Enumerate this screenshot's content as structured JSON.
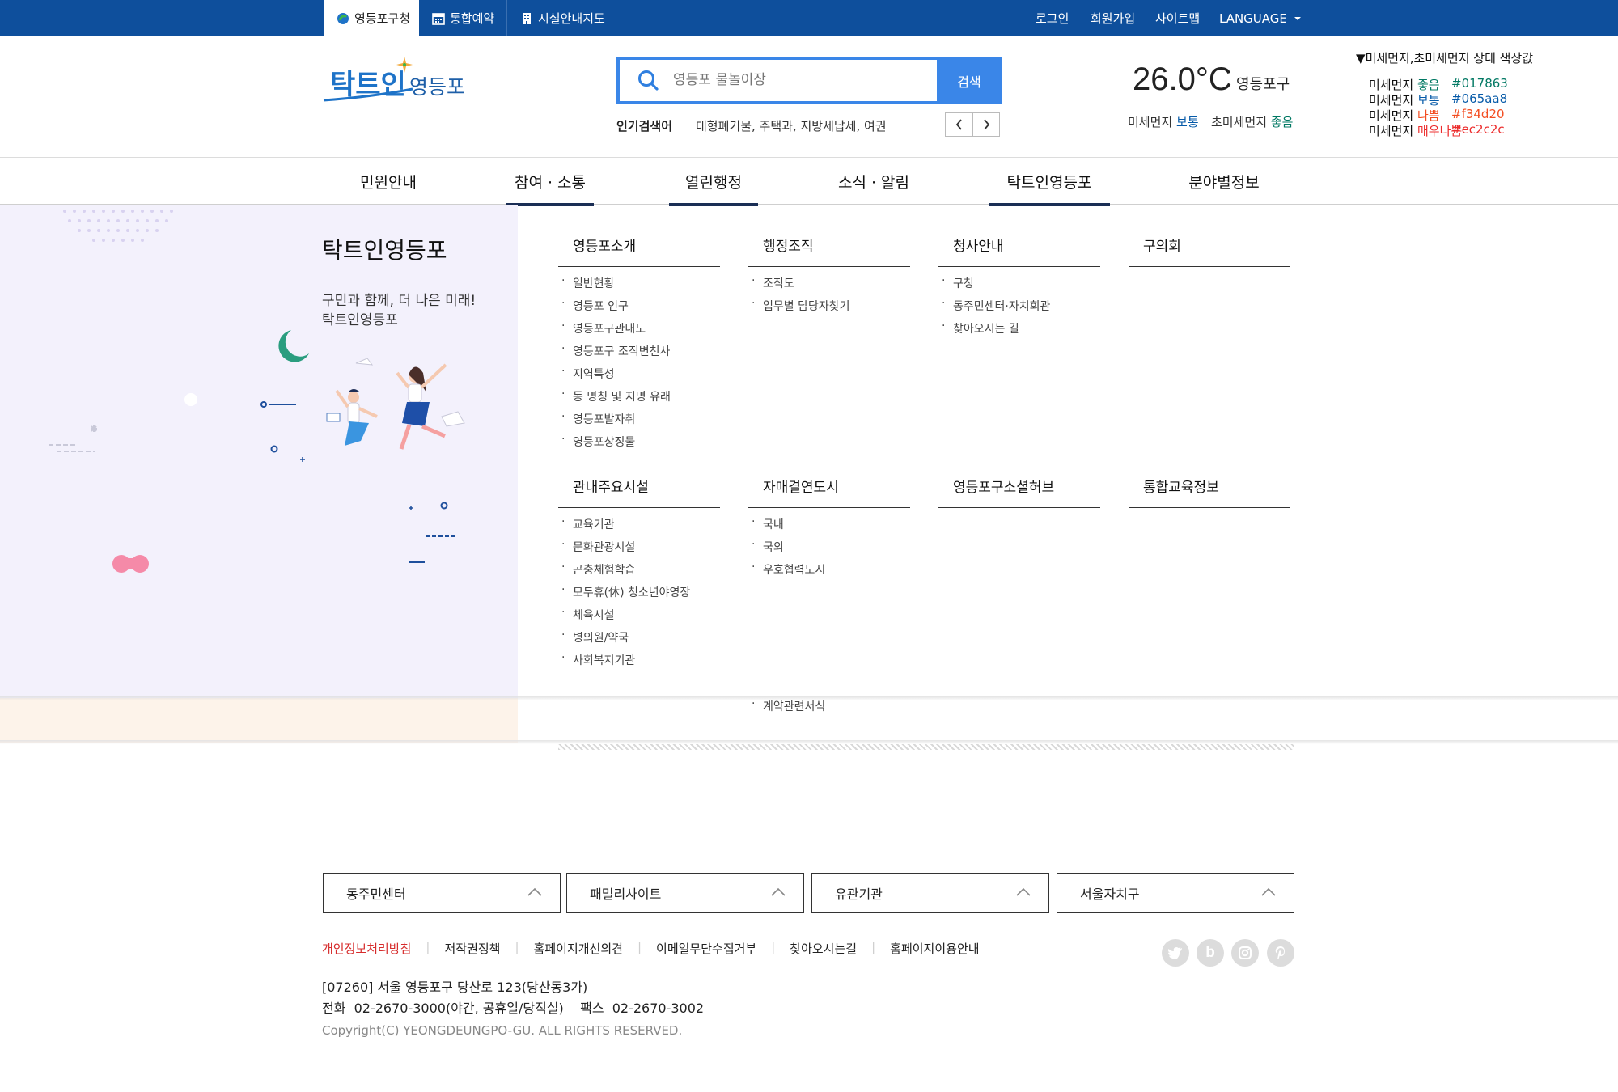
{
  "topbar": {
    "tabs": [
      {
        "label": "영등포구청",
        "icon": "site-logo-icon"
      },
      {
        "label": "통합예약",
        "icon": "calendar-icon"
      },
      {
        "label": "시설안내지도",
        "icon": "building-icon"
      }
    ],
    "util": {
      "login": "로그인",
      "join": "회원가입",
      "sitemap": "사이트맵",
      "language": "LANGUAGE"
    }
  },
  "header": {
    "logo": {
      "main": "탁트인",
      "sub": "영등포"
    },
    "search": {
      "placeholder": "영등포 물놀이장",
      "button": "검색"
    },
    "popular": {
      "label": "인기검색어",
      "words": "대형폐기물, 주택과, 지방세납세, 여권"
    },
    "weather": {
      "temperature": "26.0°C",
      "region": "영등포구"
    },
    "dust": {
      "pm10_label": "미세먼지",
      "pm10_status": "보통",
      "pm25_label": "초미세먼지",
      "pm25_status": "좋음"
    }
  },
  "legend": {
    "title": "▼미세먼지,초미세먼지 상태 색상값",
    "rows": [
      {
        "prefix": "미세먼지",
        "status": "좋음",
        "code": "#017863",
        "color": "#017863"
      },
      {
        "prefix": "미세먼지",
        "status": "보통",
        "code": "#065aa8",
        "color": "#065aa8"
      },
      {
        "prefix": "미세먼지",
        "status": "나쁨",
        "code": "#f34d20",
        "color": "#f34d20"
      },
      {
        "prefix": "미세먼지",
        "status": "매우나쁨",
        "code": "#ec2c2c",
        "color": "#ec2c2c"
      }
    ]
  },
  "gnb": {
    "items": [
      "민원안내",
      "참여 · 소통",
      "열린행정",
      "소식 · 알림",
      "탁트인영등포",
      "분야별정보"
    ]
  },
  "mega": {
    "title": "탁트인영등포",
    "desc_line1": "구민과 함께, 더 나은 미래!",
    "desc_line2": "탁트인영등포",
    "columns": [
      {
        "head": "영등포소개",
        "items": [
          "일반현황",
          "영등포 인구",
          "영등포구관내도",
          "영등포구 조직변천사",
          "지역특성",
          "동 명칭 및 지명 유래",
          "영등포발자취",
          "영등포상징물"
        ]
      },
      {
        "head": "행정조직",
        "items": [
          "조직도",
          "업무별 담당자찾기"
        ]
      },
      {
        "head": "청사안내",
        "items": [
          "구청",
          "동주민센터·자치회관",
          "찾아오시는 길"
        ]
      },
      {
        "head": "구의회",
        "items": []
      },
      {
        "head": "관내주요시설",
        "items": [
          "교육기관",
          "문화관광시설",
          "곤충체험학습",
          "모두휴(休) 청소년야영장",
          "체육시설",
          "병의원/약국",
          "사회복지기관"
        ]
      },
      {
        "head": "자매결연도시",
        "items": [
          "국내",
          "국외",
          "우호협력도시"
        ]
      },
      {
        "head": "영등포구소셜허브",
        "items": []
      },
      {
        "head": "통합교육정보",
        "items": []
      }
    ],
    "overflow_item": "계약관련서식"
  },
  "footer": {
    "selects": [
      "동주민센터",
      "패밀리사이트",
      "유관기관",
      "서울자치구"
    ],
    "links": [
      "개인정보처리방침",
      "저작권정책",
      "홈페이지개선의견",
      "이메일무단수집거부",
      "찾아오시는길",
      "홈페이지이용안내"
    ],
    "address": "[07260] 서울 영등포구 당산로 123(당산동3가)",
    "phone": "전화  02-2670-3000(야간, 공휴일/당직실)    팩스  02-2670-3002",
    "copyright": "Copyright(C) YEONGDEUNGPO-GU. ALL RIGHTS RESERVED.",
    "sns": [
      "twitter-icon",
      "blog-icon",
      "instagram-icon",
      "pinterest-icon"
    ]
  },
  "colors": {
    "topbar": "#0e4f9c",
    "search_accent": "#3a86e8",
    "gnb_active": "#1a2e55",
    "mega_bg": "#f3f1fc",
    "footer_red": "#d62c2c"
  }
}
